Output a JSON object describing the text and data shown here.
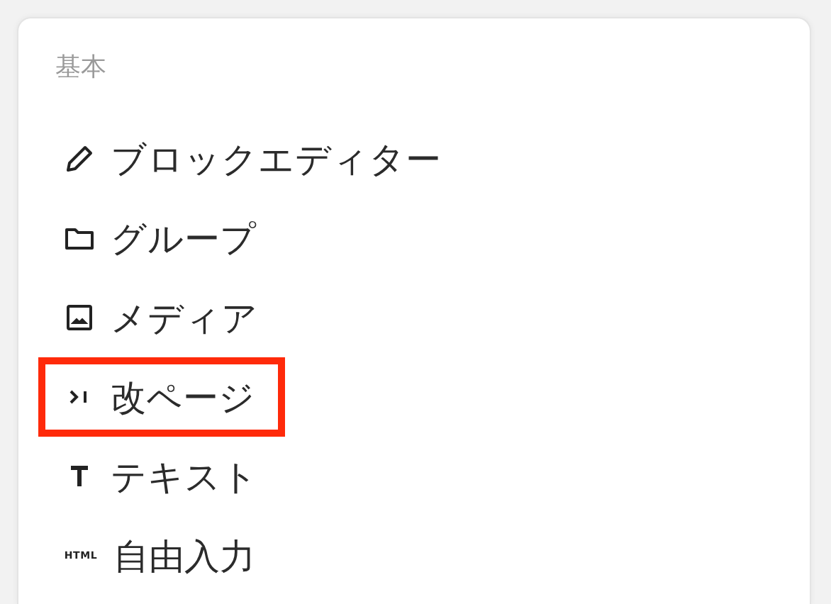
{
  "panel": {
    "heading": "基本",
    "items": [
      {
        "kind": "pencil",
        "label": "ブロックエディター",
        "highlighted": false
      },
      {
        "kind": "folder",
        "label": "グループ",
        "highlighted": false
      },
      {
        "kind": "image",
        "label": "メディア",
        "highlighted": false
      },
      {
        "kind": "pagebreak",
        "label": "改ページ",
        "highlighted": true
      },
      {
        "kind": "text",
        "label": "テキスト",
        "highlighted": false
      },
      {
        "kind": "html",
        "icon_text": "HTML",
        "label": "自由入力",
        "highlighted": false
      }
    ]
  }
}
